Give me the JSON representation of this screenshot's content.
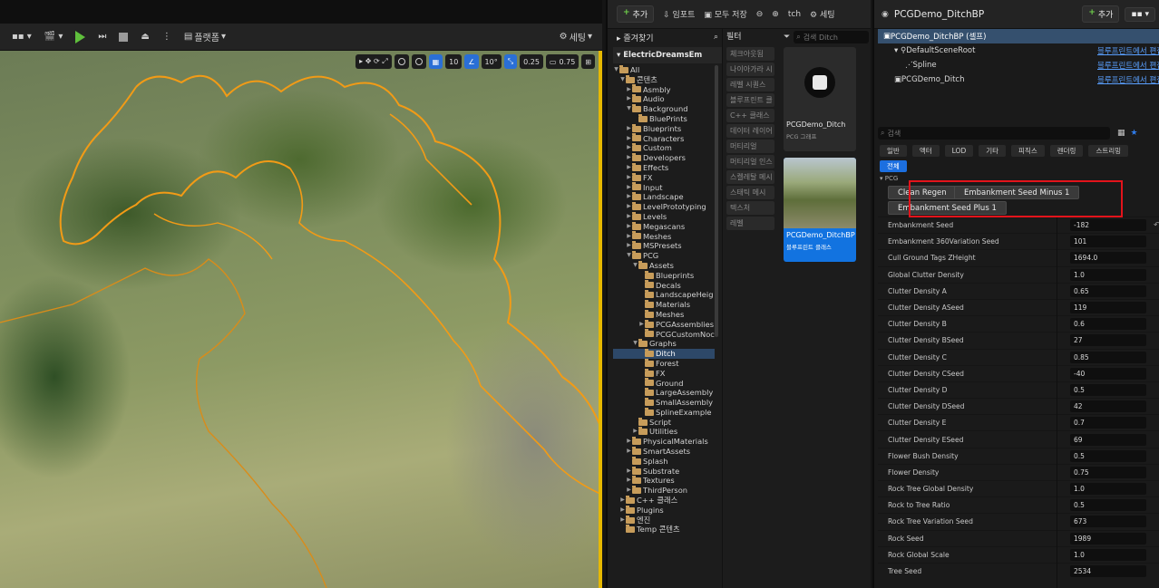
{
  "viewport": {
    "toolbar": {
      "platforms_label": "플랫폼",
      "settings_label": "세팅"
    },
    "widgets": {
      "grid_value": "10",
      "angle_value": "10°",
      "scale_value": "0.25",
      "camera_speed": "0.75"
    }
  },
  "content_browser": {
    "toolbar": {
      "add_label": "추가",
      "import_label": "임포트",
      "save_all_label": "모두 저장",
      "path_tail": "tch",
      "settings_label": "세팅"
    },
    "favorites_label": "즐겨찾기",
    "root_label": "ElectricDreamsEm",
    "filter_title": "필터",
    "filters": [
      "체크아웃됨",
      "나이아가라 시",
      "레벨 시퀀스",
      "블루프린트 클",
      "C++ 클래스",
      "데이터 레이어",
      "머티리얼",
      "머티리얼 인스",
      "스켈레탈 메시",
      "스태틱 메시",
      "텍스처",
      "레벨"
    ],
    "search_placeholder": "검색 Ditch",
    "tree": [
      {
        "label": "All",
        "depth": 0,
        "arrow": "down"
      },
      {
        "label": "콘텐츠",
        "depth": 1,
        "arrow": "down"
      },
      {
        "label": "Asmbly",
        "depth": 2,
        "arrow": "right"
      },
      {
        "label": "Audio",
        "depth": 2,
        "arrow": "right"
      },
      {
        "label": "Background",
        "depth": 2,
        "arrow": "down"
      },
      {
        "label": "BluePrints",
        "depth": 3,
        "arrow": ""
      },
      {
        "label": "Blueprints",
        "depth": 2,
        "arrow": "right"
      },
      {
        "label": "Characters",
        "depth": 2,
        "arrow": "right"
      },
      {
        "label": "Custom",
        "depth": 2,
        "arrow": "right"
      },
      {
        "label": "Developers",
        "depth": 2,
        "arrow": "right"
      },
      {
        "label": "Effects",
        "depth": 2,
        "arrow": "right"
      },
      {
        "label": "FX",
        "depth": 2,
        "arrow": "right"
      },
      {
        "label": "Input",
        "depth": 2,
        "arrow": "right"
      },
      {
        "label": "Landscape",
        "depth": 2,
        "arrow": "right"
      },
      {
        "label": "LevelPrototyping",
        "depth": 2,
        "arrow": "right"
      },
      {
        "label": "Levels",
        "depth": 2,
        "arrow": "right"
      },
      {
        "label": "Megascans",
        "depth": 2,
        "arrow": "right"
      },
      {
        "label": "Meshes",
        "depth": 2,
        "arrow": "right"
      },
      {
        "label": "MSPresets",
        "depth": 2,
        "arrow": "right"
      },
      {
        "label": "PCG",
        "depth": 2,
        "arrow": "down"
      },
      {
        "label": "Assets",
        "depth": 3,
        "arrow": "down"
      },
      {
        "label": "Blueprints",
        "depth": 4,
        "arrow": ""
      },
      {
        "label": "Decals",
        "depth": 4,
        "arrow": ""
      },
      {
        "label": "LandscapeHeig",
        "depth": 4,
        "arrow": ""
      },
      {
        "label": "Materials",
        "depth": 4,
        "arrow": ""
      },
      {
        "label": "Meshes",
        "depth": 4,
        "arrow": ""
      },
      {
        "label": "PCGAssemblies",
        "depth": 4,
        "arrow": "right"
      },
      {
        "label": "PCGCustomNoc",
        "depth": 4,
        "arrow": ""
      },
      {
        "label": "Graphs",
        "depth": 3,
        "arrow": "down"
      },
      {
        "label": "Ditch",
        "depth": 4,
        "arrow": "",
        "selected": true
      },
      {
        "label": "Forest",
        "depth": 4,
        "arrow": ""
      },
      {
        "label": "FX",
        "depth": 4,
        "arrow": ""
      },
      {
        "label": "Ground",
        "depth": 4,
        "arrow": ""
      },
      {
        "label": "LargeAssembly",
        "depth": 4,
        "arrow": ""
      },
      {
        "label": "SmallAssembly",
        "depth": 4,
        "arrow": ""
      },
      {
        "label": "SplineExample",
        "depth": 4,
        "arrow": ""
      },
      {
        "label": "Script",
        "depth": 3,
        "arrow": ""
      },
      {
        "label": "Utilities",
        "depth": 3,
        "arrow": "right"
      },
      {
        "label": "PhysicalMaterials",
        "depth": 2,
        "arrow": "right"
      },
      {
        "label": "SmartAssets",
        "depth": 2,
        "arrow": "right"
      },
      {
        "label": "Splash",
        "depth": 2,
        "arrow": ""
      },
      {
        "label": "Substrate",
        "depth": 2,
        "arrow": "right"
      },
      {
        "label": "Textures",
        "depth": 2,
        "arrow": "right"
      },
      {
        "label": "ThirdPerson",
        "depth": 2,
        "arrow": "right"
      },
      {
        "label": "C++ 클래스",
        "depth": 1,
        "arrow": "right"
      },
      {
        "label": "Plugins",
        "depth": 1,
        "arrow": "right"
      },
      {
        "label": "엔진",
        "depth": 1,
        "arrow": "right"
      },
      {
        "label": "Temp 콘텐츠",
        "depth": 1,
        "arrow": ""
      }
    ],
    "assets": [
      {
        "name": "PCGDemo_Ditch",
        "type": "PCG 그래프",
        "selected": false
      },
      {
        "name": "PCGDemo_DitchBP",
        "type": "블루프린트 클래스",
        "selected": true
      }
    ]
  },
  "details": {
    "title": "PCGDemo_DitchBP",
    "add_label": "추가",
    "components": [
      {
        "label": "PCGDemo_DitchBP (셀프)",
        "edit": "",
        "indent": 0,
        "selected": true
      },
      {
        "label": "DefaultSceneRoot",
        "edit": "블루프린트에서 편집",
        "indent": 1,
        "selected": false
      },
      {
        "label": "Spline",
        "edit": "블루프린트에서 편집",
        "indent": 2,
        "selected": false
      },
      {
        "label": "PCGDemo_Ditch",
        "edit": "블루프린트에서 편집",
        "indent": 1,
        "selected": false
      }
    ],
    "search_placeholder": "검색",
    "categories": [
      "일반",
      "액터",
      "LOD",
      "기타",
      "피직스",
      "렌더링",
      "스트리밍",
      "전체"
    ],
    "active_category": "전체",
    "section_label": "PCG",
    "buttons": [
      "Clean Regen",
      "Embankment Seed Minus 1",
      "Embankment Seed Plus 1"
    ],
    "properties": [
      {
        "name": "Embankment Seed",
        "value": "-182",
        "reset": true
      },
      {
        "name": "Embankment 360Variation Seed",
        "value": "101"
      },
      {
        "name": "Cull Ground Tags ZHeight",
        "value": "1694.0"
      },
      {
        "name": "Global Clutter Density",
        "value": "1.0"
      },
      {
        "name": "Clutter Density A",
        "value": "0.65"
      },
      {
        "name": "Clutter Density ASeed",
        "value": "119"
      },
      {
        "name": "Clutter Density B",
        "value": "0.6"
      },
      {
        "name": "Clutter Density BSeed",
        "value": "27"
      },
      {
        "name": "Clutter Density C",
        "value": "0.85"
      },
      {
        "name": "Clutter Density CSeed",
        "value": "-40"
      },
      {
        "name": "Clutter Density D",
        "value": "0.5"
      },
      {
        "name": "Clutter Density DSeed",
        "value": "42"
      },
      {
        "name": "Clutter Density E",
        "value": "0.7"
      },
      {
        "name": "Clutter Density ESeed",
        "value": "69"
      },
      {
        "name": "Flower Bush Density",
        "value": "0.5"
      },
      {
        "name": "Flower Density",
        "value": "0.75"
      },
      {
        "name": "Rock Tree Global Density",
        "value": "1.0"
      },
      {
        "name": "Rock to Tree Ratio",
        "value": "0.5"
      },
      {
        "name": "Rock Tree Variation Seed",
        "value": "673"
      },
      {
        "name": "Rock Seed",
        "value": "1989"
      },
      {
        "name": "Rock Global Scale",
        "value": "1.0"
      },
      {
        "name": "Tree Seed",
        "value": "2534"
      }
    ]
  }
}
